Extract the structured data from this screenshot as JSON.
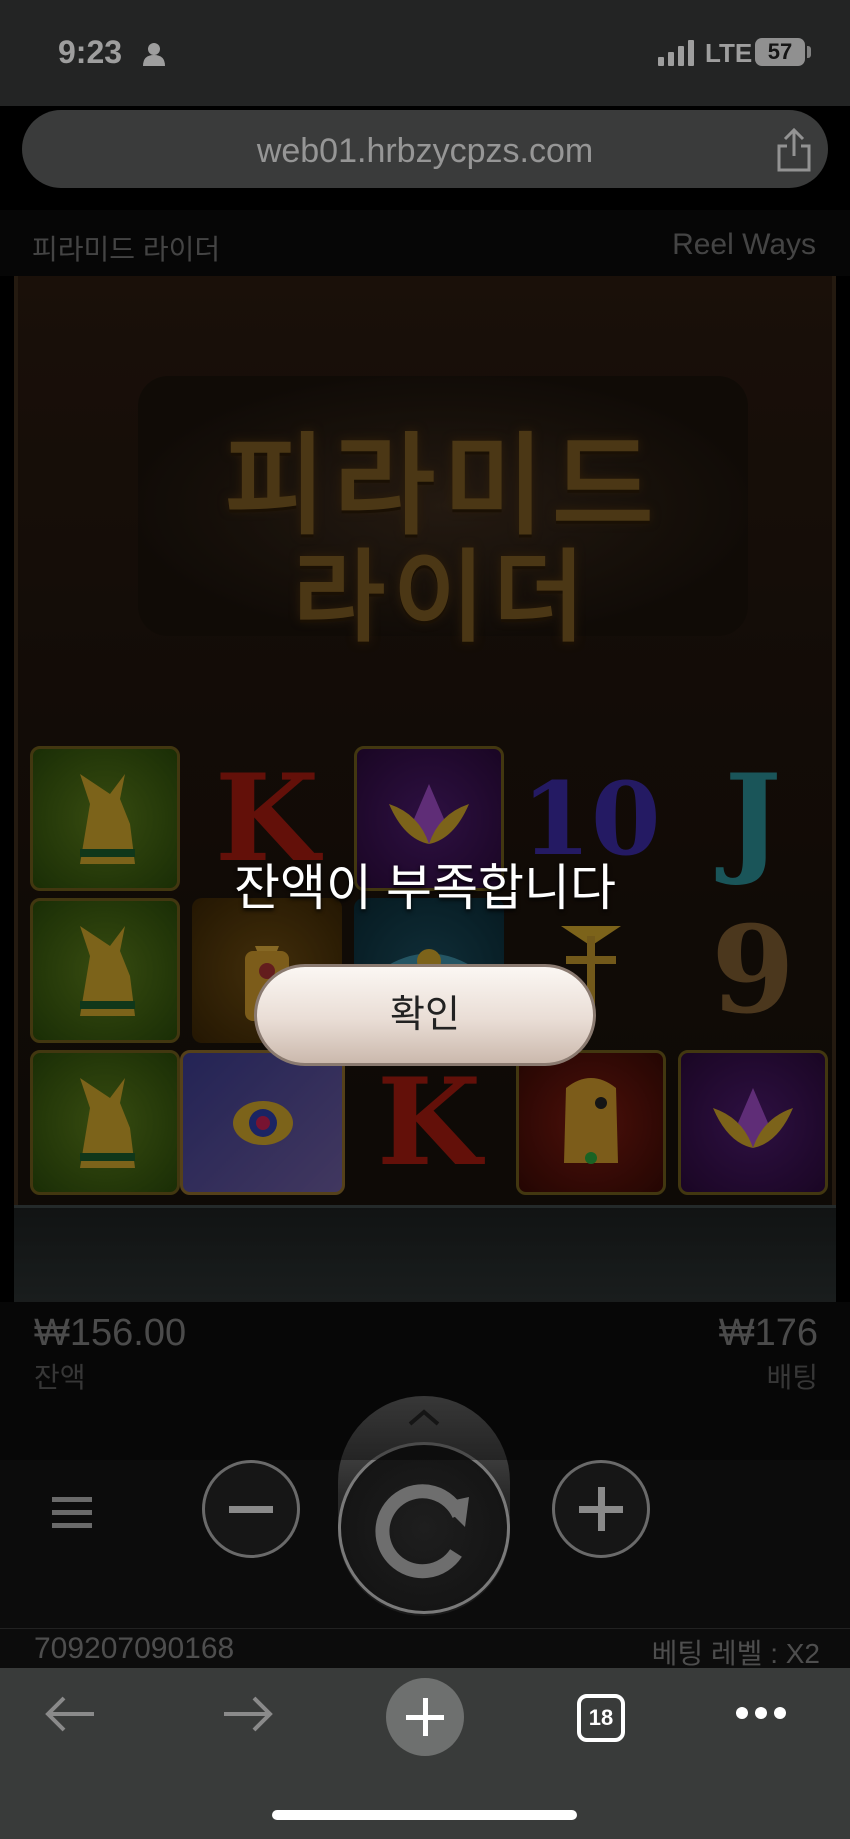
{
  "status": {
    "time": "9:23",
    "network": "LTE",
    "battery": "57"
  },
  "browser": {
    "url": "web01.hrbzycpzs.com",
    "tab_count": "18"
  },
  "game": {
    "title": "피라미드 라이더",
    "mode": "Reel Ways",
    "logo_line1": "피라미드",
    "logo_line2": "라이더",
    "balance_value": "₩156.00",
    "balance_label": "잔액",
    "bet_value": "₩176",
    "bet_label": "배팅",
    "account_id": "709207090168",
    "bet_level": "베팅 레벨 : X2"
  },
  "dialog": {
    "message": "잔액이 부족합니다",
    "confirm_label": "확인"
  },
  "reels": {
    "letters": {
      "k": "K",
      "ten": "10",
      "j": "J",
      "nine": "9"
    }
  }
}
